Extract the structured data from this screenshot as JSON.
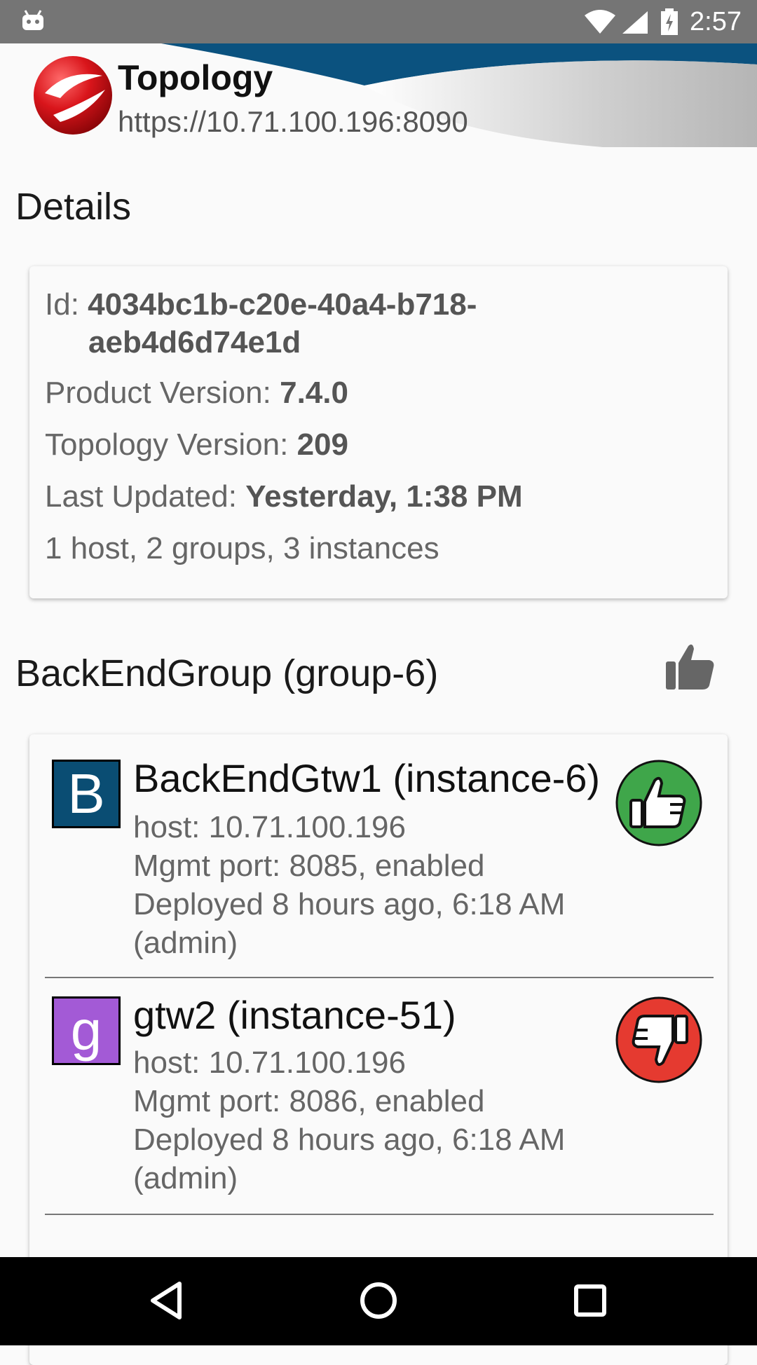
{
  "status_bar": {
    "time": "2:57"
  },
  "header": {
    "title": "Topology",
    "url": "https://10.71.100.196:8090"
  },
  "details": {
    "section_title": "Details",
    "id_label": "Id:",
    "id_value_line1": "4034bc1b-c20e-40a4-b718-",
    "id_value_line2": "aeb4d6d74e1d",
    "product_version_label": "Product Version:",
    "product_version_value": "7.4.0",
    "topology_version_label": "Topology Version:",
    "topology_version_value": "209",
    "last_updated_label": "Last Updated:",
    "last_updated_value": "Yesterday, 1:38 PM",
    "summary": "1 host, 2 groups, 3 instances"
  },
  "group": {
    "title": "BackEndGroup (group-6)",
    "status": "thumbs-up-icon",
    "instances": [
      {
        "icon_letter": "B",
        "icon_color": "#0a4d73",
        "name": "BackEndGtw1 (instance-6)",
        "host": "host: 10.71.100.196",
        "mgmt": "Mgmt port: 8085, enabled",
        "deployed": "Deployed 8 hours ago, 6:18 AM",
        "deployed_by": "(admin)",
        "status": "thumbs-up-icon",
        "status_color": "#3fa64a"
      },
      {
        "icon_letter": "g",
        "icon_color": "#a35ad6",
        "name": "gtw2 (instance-51)",
        "host": "host: 10.71.100.196",
        "mgmt": "Mgmt port: 8086, enabled",
        "deployed": "Deployed 8 hours ago, 6:18 AM",
        "deployed_by": "(admin)",
        "status": "thumbs-down-icon",
        "status_color": "#e53a30"
      }
    ]
  }
}
